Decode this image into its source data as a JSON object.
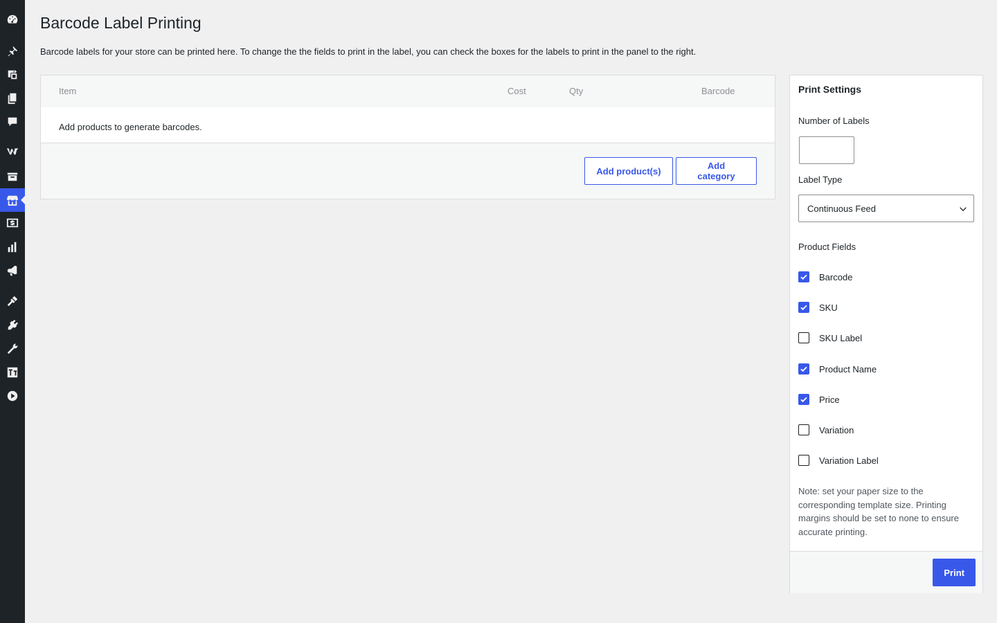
{
  "sidebar": {
    "items": [
      {
        "icon": "dashboard-icon"
      },
      {
        "icon": "pin-icon"
      },
      {
        "icon": "media-icon"
      },
      {
        "icon": "pages-icon"
      },
      {
        "icon": "comments-icon"
      },
      {
        "icon": "woocommerce-icon"
      },
      {
        "icon": "products-icon"
      },
      {
        "icon": "store-icon",
        "active": true
      },
      {
        "icon": "payments-icon"
      },
      {
        "icon": "analytics-icon"
      },
      {
        "icon": "marketing-icon"
      },
      {
        "icon": "appearance-icon"
      },
      {
        "icon": "plugins-icon"
      },
      {
        "icon": "tools-icon"
      },
      {
        "icon": "settings-icon"
      },
      {
        "icon": "play-icon"
      }
    ]
  },
  "page": {
    "title": "Barcode Label Printing",
    "description": "Barcode labels for your store can be printed here. To change the the fields to print in the label, you can check the boxes for the labels to print in the panel to the right."
  },
  "items_table": {
    "columns": [
      "Item",
      "Cost",
      "Qty",
      "Barcode"
    ],
    "empty_message": "Add products to generate barcodes.",
    "add_products_label": "Add product(s)",
    "add_category_label": "Add category"
  },
  "print_settings": {
    "title": "Print Settings",
    "number_of_labels_label": "Number of Labels",
    "number_of_labels_value": "",
    "label_type_label": "Label Type",
    "label_type_value": "Continuous Feed",
    "product_fields_label": "Product Fields",
    "fields": [
      {
        "label": "Barcode",
        "checked": true
      },
      {
        "label": "SKU",
        "checked": true
      },
      {
        "label": "SKU Label",
        "checked": false
      },
      {
        "label": "Product Name",
        "checked": true
      },
      {
        "label": "Price",
        "checked": true
      },
      {
        "label": "Variation",
        "checked": false
      },
      {
        "label": "Variation Label",
        "checked": false
      }
    ],
    "note": "Note: set your paper size to the corresponding template size. Printing margins should be set to none to ensure accurate printing.",
    "print_label": "Print"
  },
  "colors": {
    "accent": "#3858e9",
    "sidebar_bg": "#1d2327",
    "page_bg": "#f0f0f1"
  }
}
